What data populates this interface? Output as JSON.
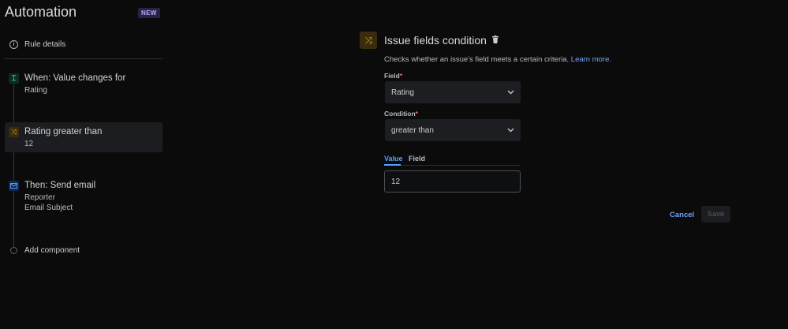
{
  "sidebar": {
    "title": "Automation",
    "badge": "NEW",
    "rule_details": "Rule details",
    "trigger": {
      "title": "When: Value changes for",
      "sub": "Rating",
      "icon": "trigger-icon"
    },
    "condition": {
      "title": "Rating greater than",
      "sub": "12",
      "icon": "branch-icon"
    },
    "action": {
      "title": "Then: Send email",
      "sub1": "Reporter",
      "sub2": "Email Subject",
      "icon": "mail-icon"
    },
    "add_component": "Add component"
  },
  "panel": {
    "title": "Issue fields condition",
    "description": "Checks whether an issue's field meets a certain criteria.",
    "learn_more": "Learn more.",
    "field_label": "Field",
    "field_value": "Rating",
    "condition_label": "Condition",
    "condition_value": "greater than",
    "tabs": [
      "Value",
      "Field"
    ],
    "value": "12",
    "cancel": "Cancel",
    "save": "Save",
    "required_mark": "*"
  },
  "colors": {
    "accent": "#579dff",
    "condition": "#e2b203",
    "trigger": "#4bce97",
    "required": "#f87168"
  }
}
